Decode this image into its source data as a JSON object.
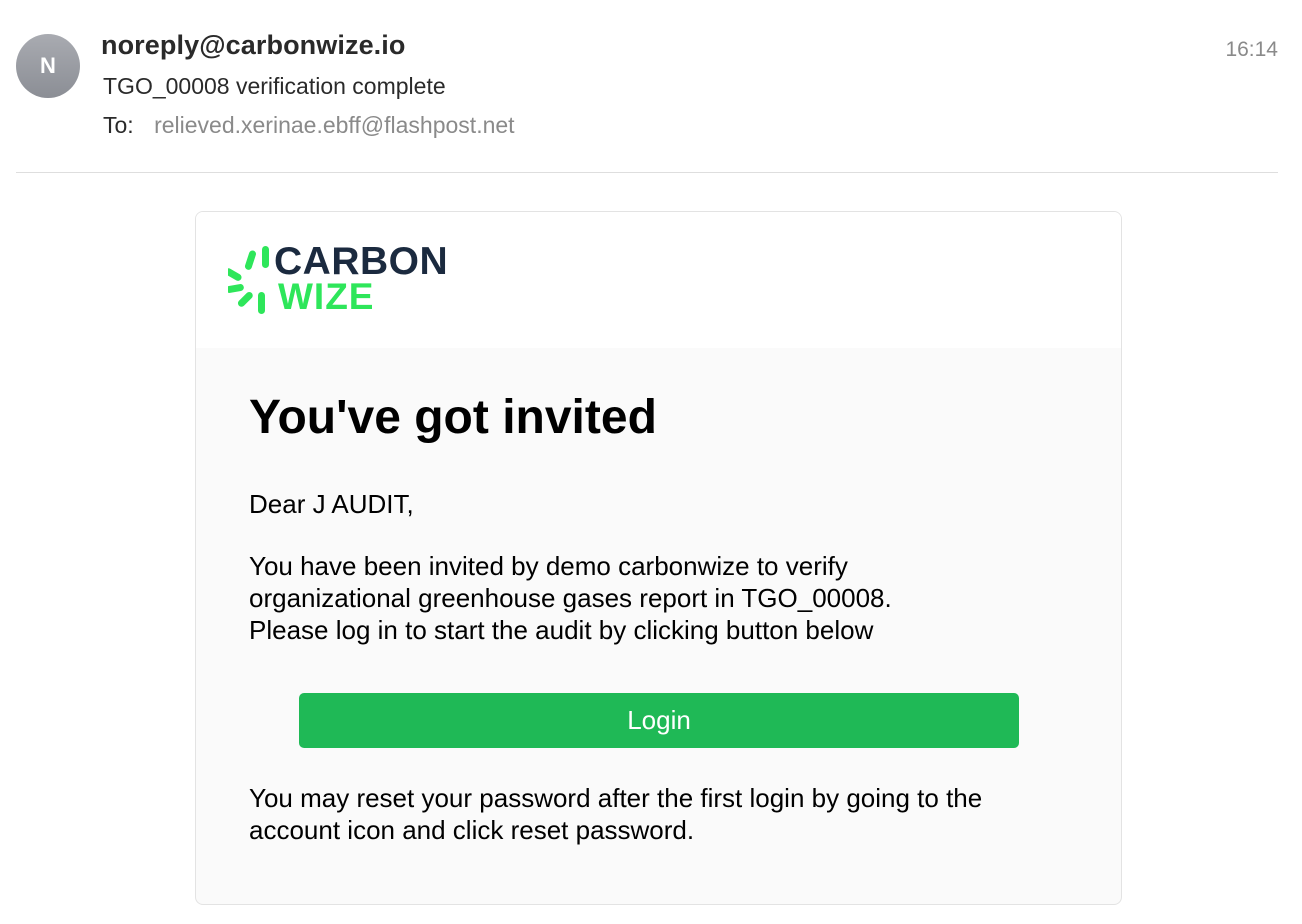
{
  "email": {
    "avatar_initial": "N",
    "sender": "noreply@carbonwize.io",
    "subject": "TGO_00008 verification complete",
    "to_label": "To:",
    "to_address": "relieved.xerinae.ebff@flashpost.net",
    "time": "16:14"
  },
  "brand": {
    "name_line1": "CARBON",
    "name_line2": "WIZE",
    "logo_icon": "burst-icon",
    "colors": {
      "dark": "#1b2a3f",
      "green": "#2ee65a",
      "button": "#1fb956"
    }
  },
  "message": {
    "heading": "You've got invited",
    "greeting": "Dear J AUDIT,",
    "paragraph_lines": [
      "You have been invited by demo carbonwize to verify",
      "organizational greenhouse gases report in TGO_00008.",
      "Please log in to start the audit by clicking button below"
    ],
    "button_label": "Login",
    "footer_lines": [
      "You may reset your password after the first login by going to the",
      "account icon and click reset password."
    ]
  }
}
